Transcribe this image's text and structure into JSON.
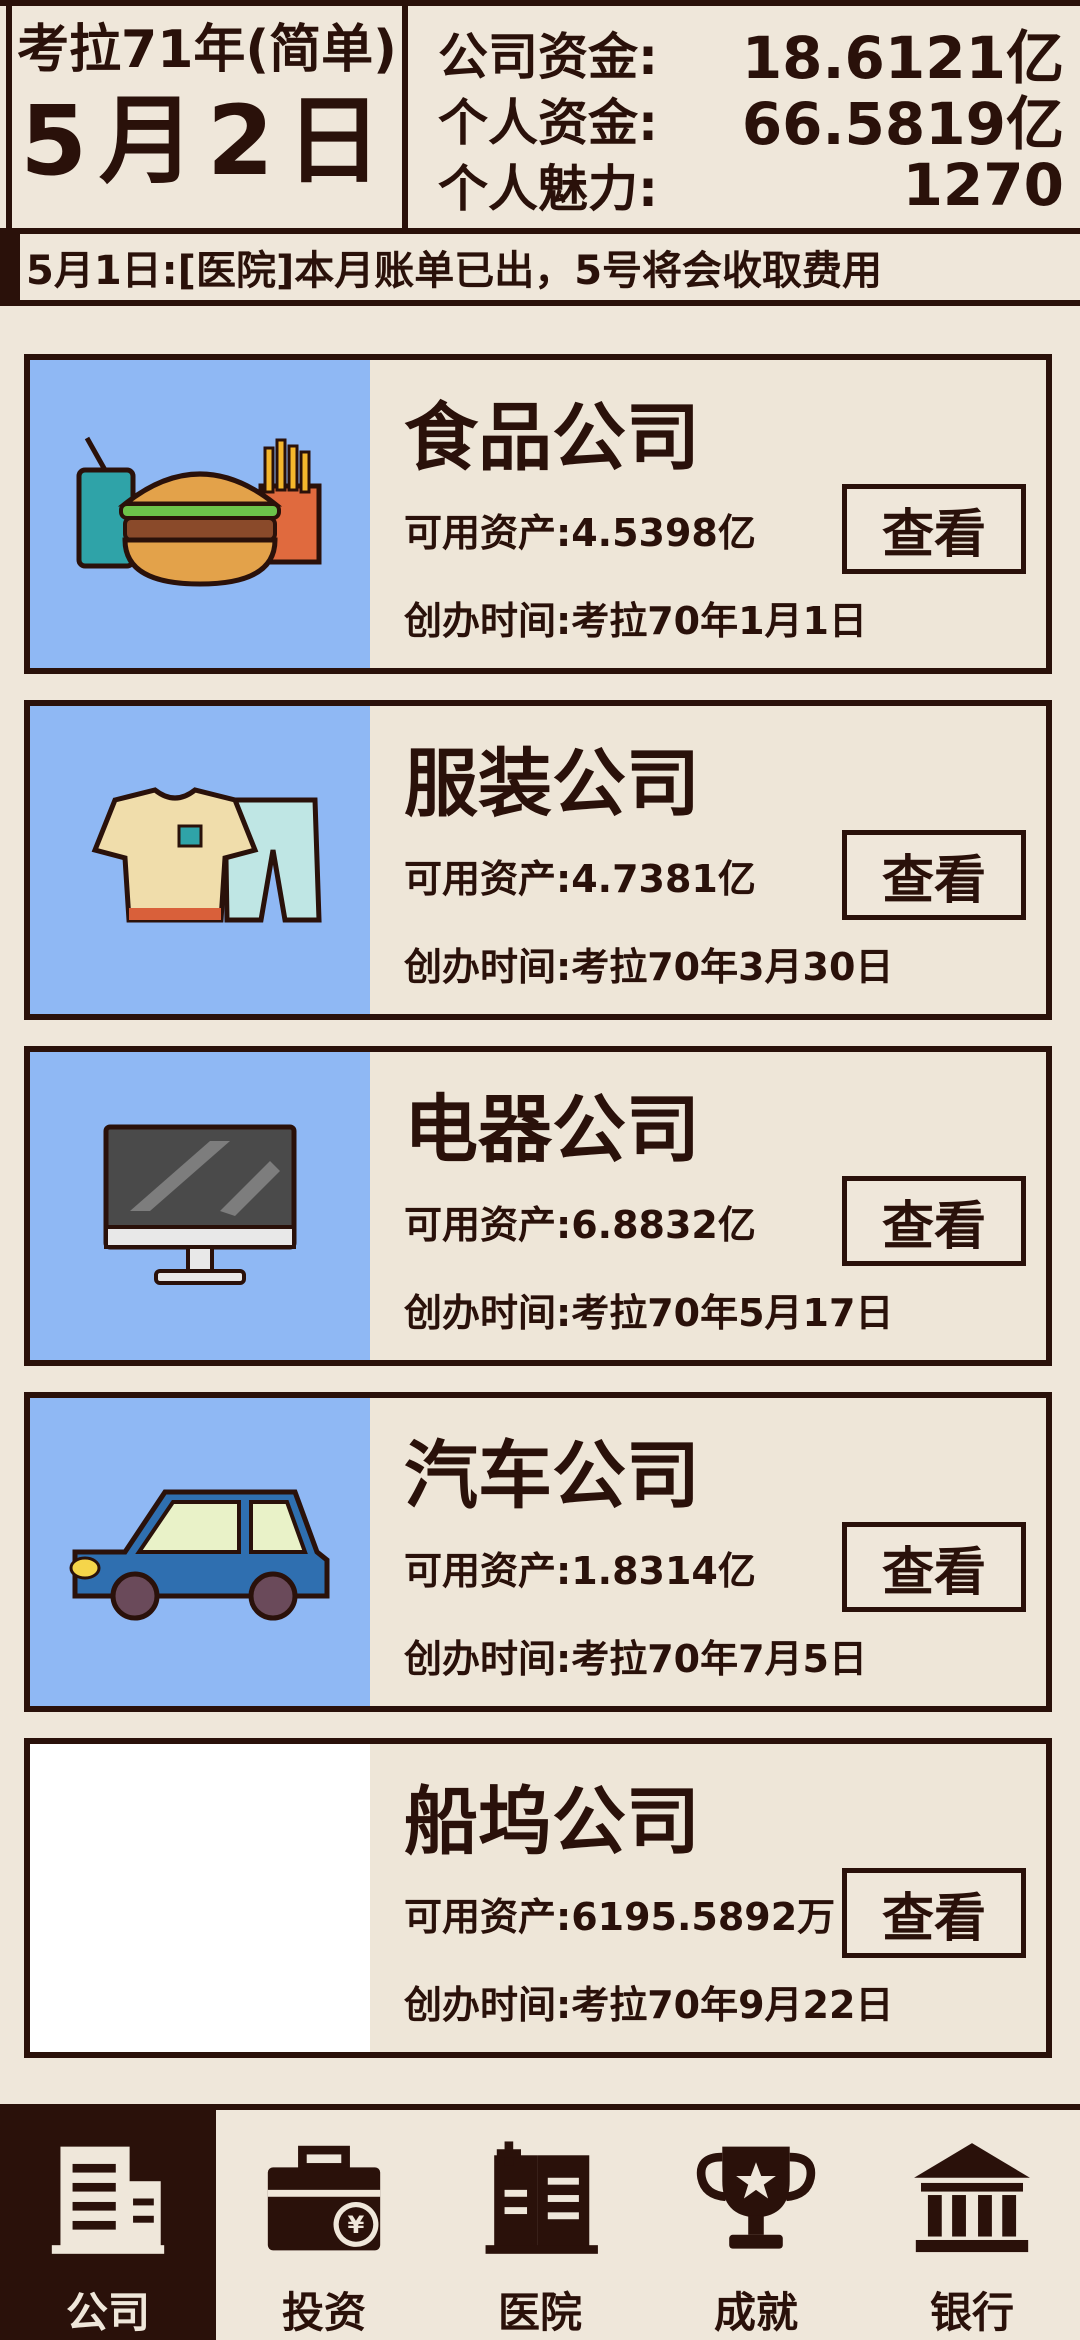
{
  "header": {
    "year_label": "考拉71年(简单)",
    "date_label": "5月2日",
    "stats": [
      {
        "label": "公司资金:",
        "value": "18.6121亿"
      },
      {
        "label": "个人资金:",
        "value": "66.5819亿"
      },
      {
        "label": "个人魅力:",
        "value": "1270"
      }
    ]
  },
  "notice": {
    "text": "5月1日:[医院]本月账单已出，5号将会收取费用"
  },
  "companies": [
    {
      "name": "食品公司",
      "assets": "可用资产:4.5398亿",
      "founded": "创办时间:考拉70年1月1日",
      "button": "查看",
      "icon": "fast-food-icon"
    },
    {
      "name": "服装公司",
      "assets": "可用资产:4.7381亿",
      "founded": "创办时间:考拉70年3月30日",
      "button": "查看",
      "icon": "clothing-icon"
    },
    {
      "name": "电器公司",
      "assets": "可用资产:6.8832亿",
      "founded": "创办时间:考拉70年5月17日",
      "button": "查看",
      "icon": "monitor-icon"
    },
    {
      "name": "汽车公司",
      "assets": "可用资产:1.8314亿",
      "founded": "创办时间:考拉70年7月5日",
      "button": "查看",
      "icon": "car-icon"
    },
    {
      "name": "船坞公司",
      "assets": "可用资产:6195.5892万",
      "founded": "创办时间:考拉70年9月22日",
      "button": "查看",
      "icon": ""
    }
  ],
  "nav": [
    {
      "label": "公司",
      "icon": "company-building-icon",
      "active": true
    },
    {
      "label": "投资",
      "icon": "briefcase-yen-icon",
      "active": false
    },
    {
      "label": "医院",
      "icon": "hospital-icon",
      "active": false
    },
    {
      "label": "成就",
      "icon": "trophy-icon",
      "active": false
    },
    {
      "label": "银行",
      "icon": "bank-icon",
      "active": false
    }
  ],
  "colors": {
    "dark": "#2a110a",
    "background": "#efe7da",
    "image_blue": "#8fb8f4"
  }
}
